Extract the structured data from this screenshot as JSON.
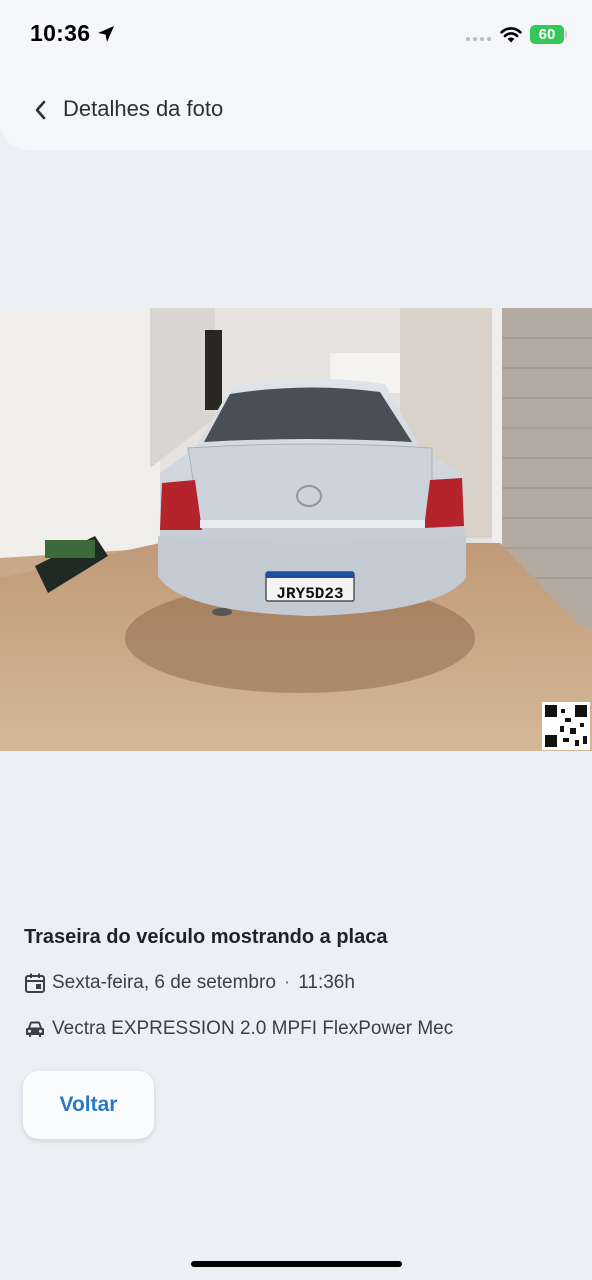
{
  "status_bar": {
    "time": "10:36",
    "battery": "60"
  },
  "header": {
    "title": "Detalhes da foto",
    "back_icon": "chevron-left-icon"
  },
  "photo": {
    "plate_text": "JRY5D23"
  },
  "details": {
    "caption": "Traseira do veículo mostrando a placa",
    "date": "Sexta-feira, 6 de setembro",
    "separator": "·",
    "time": "11:36h",
    "vehicle": "Vectra EXPRESSION 2.0 MPFI FlexPower Mec"
  },
  "actions": {
    "back_label": "Voltar"
  },
  "colors": {
    "accent": "#2979c8",
    "battery": "#34c759",
    "background": "#eceff3"
  }
}
